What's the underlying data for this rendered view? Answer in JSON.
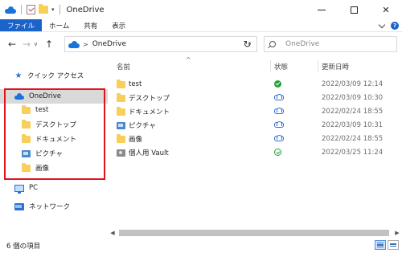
{
  "window": {
    "title": "OneDrive",
    "minimize_glyph": "—",
    "close_glyph": "✕"
  },
  "ribbon": {
    "tabs": [
      {
        "label": "ファイル",
        "active": true
      },
      {
        "label": "ホーム",
        "active": false
      },
      {
        "label": "共有",
        "active": false
      },
      {
        "label": "表示",
        "active": false
      }
    ],
    "help_label": "?"
  },
  "navigation": {
    "back": "←",
    "forward": "→",
    "recent": "∨",
    "up": "↑",
    "address_path": "OneDrive",
    "address_separator": ">",
    "refresh": "↻",
    "search_placeholder": "OneDrive"
  },
  "nav_pane": {
    "items": [
      {
        "label": "クイック アクセス",
        "icon": "star-icon",
        "indent": 0,
        "selected": false
      },
      {
        "label": "OneDrive",
        "icon": "onedrive-cloud-icon",
        "indent": 0,
        "selected": true
      },
      {
        "label": "test",
        "icon": "folder-icon",
        "indent": 1,
        "selected": false
      },
      {
        "label": "デスクトップ",
        "icon": "folder-icon",
        "indent": 1,
        "selected": false
      },
      {
        "label": "ドキュメント",
        "icon": "folder-icon",
        "indent": 1,
        "selected": false
      },
      {
        "label": "ピクチャ",
        "icon": "pictures-folder-icon",
        "indent": 1,
        "selected": false
      },
      {
        "label": "画像",
        "icon": "folder-icon",
        "indent": 1,
        "selected": false
      },
      {
        "label": "PC",
        "icon": "pc-icon",
        "indent": 0,
        "selected": false
      },
      {
        "label": "ネットワーク",
        "icon": "network-icon",
        "indent": 0,
        "selected": false
      }
    ]
  },
  "file_list": {
    "columns": {
      "name": "名前",
      "status": "状態",
      "modified": "更新日時"
    },
    "sort_indicator": "^",
    "rows": [
      {
        "name": "test",
        "icon": "folder-icon",
        "status": "always-available-icon",
        "modified": "2022/03/09 12:14"
      },
      {
        "name": "デスクトップ",
        "icon": "folder-icon",
        "status": "cloud-only-icon",
        "modified": "2022/03/09 10:30"
      },
      {
        "name": "ドキュメント",
        "icon": "folder-icon",
        "status": "cloud-only-icon",
        "modified": "2022/02/24 18:55"
      },
      {
        "name": "ピクチャ",
        "icon": "pictures-folder-icon",
        "status": "cloud-only-icon",
        "modified": "2022/03/09 10:31"
      },
      {
        "name": "画像",
        "icon": "folder-icon",
        "status": "cloud-only-icon",
        "modified": "2022/02/24 18:55"
      },
      {
        "name": "個人用 Vault",
        "icon": "vault-icon",
        "status": "available-offline-icon",
        "modified": "2022/03/25 11:24"
      }
    ]
  },
  "status_bar": {
    "item_count": "6 個の項目"
  },
  "colors": {
    "accent": "#1a63c8",
    "highlight_box": "#e0121c",
    "folder": "#f7cf5a",
    "synced_green": "#21a038",
    "cloud_blue": "#2f6fd1"
  }
}
